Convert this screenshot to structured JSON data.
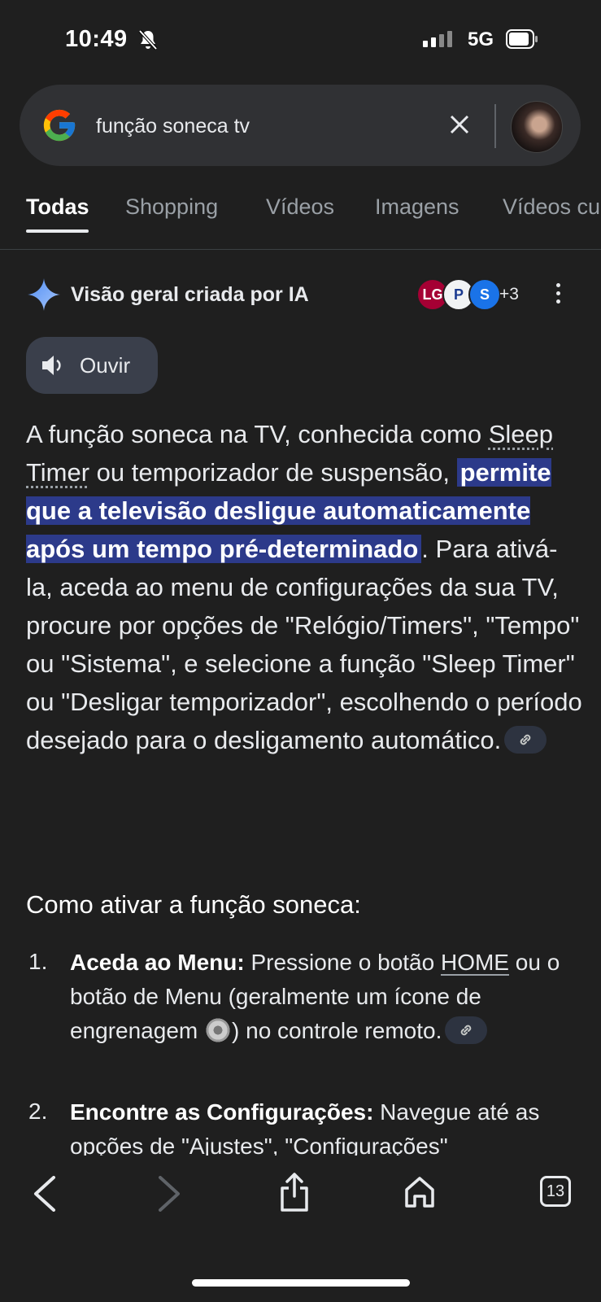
{
  "status_bar": {
    "time": "10:49",
    "network": "5G"
  },
  "search": {
    "query": "função soneca tv"
  },
  "tabs": [
    {
      "label": "Todas"
    },
    {
      "label": "Shopping"
    },
    {
      "label": "Vídeos"
    },
    {
      "label": "Imagens"
    },
    {
      "label": "Vídeos cu"
    }
  ],
  "ai_overview": {
    "title": "Visão geral criada por IA",
    "sources": [
      "LG",
      "P",
      "S"
    ],
    "more_sources": "+3",
    "listen_label": "Ouvir",
    "para_1": "A função soneca na TV, conhecida como ",
    "para_term": "Sleep Timer",
    "para_2": " ou temporizador de suspensão, ",
    "para_highlight": "permite que a televisão desligue automaticamente após um tempo pré-determinado",
    "para_3": ". Para ativá-la, aceda ao menu de configurações da sua TV, procure por opções de \"Relógio/Timers\", \"Tempo\" ou \"Sistema\", e selecione a função \"Sleep Timer\" ou \"Desligar temporizador\", escolhendo o período desejado para o desligamento automático.",
    "subheading": "Como ativar a função soneca:",
    "steps": [
      {
        "num": "1.",
        "bold": "Aceda ao Menu:",
        "text_a": " Pressione o botão ",
        "term": "HOME",
        "text_b": " ou o botão de Menu (geralmente um ícone de engrenagem ",
        "text_c": ") no controle remoto."
      },
      {
        "num": "2.",
        "bold": "Encontre as Configurações:",
        "text_a": " Navegue até as opções de \"Ajustes\", \"Configurações\""
      }
    ]
  },
  "bottom_bar": {
    "tab_count": "13"
  }
}
